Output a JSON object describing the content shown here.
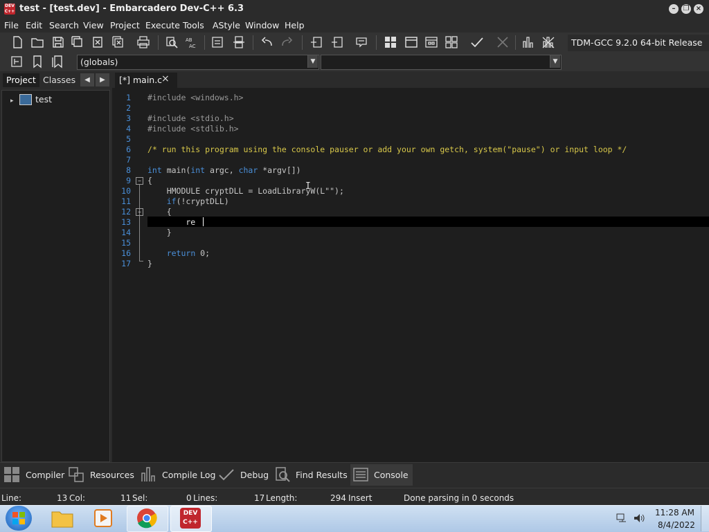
{
  "window": {
    "title": "test - [test.dev] - Embarcadero Dev-C++ 6.3",
    "logo_text": "DEV C++"
  },
  "menu": [
    "File",
    "Edit",
    "Search",
    "View",
    "Project",
    "Execute",
    "Tools",
    "AStyle",
    "Window",
    "Help"
  ],
  "toolbar": {
    "compiler": "TDM-GCC 9.2.0 64-bit Release",
    "scope_select": "(globals)"
  },
  "left_panel": {
    "tabs": [
      "Project",
      "Classes"
    ],
    "tree_root": "test"
  },
  "editor": {
    "tab_label": "[*] main.c",
    "lines": [
      {
        "n": "1",
        "text": "#include <windows.h>"
      },
      {
        "n": "2",
        "text": ""
      },
      {
        "n": "3",
        "text": "#include <stdio.h>"
      },
      {
        "n": "4",
        "text": "#include <stdlib.h>"
      },
      {
        "n": "5",
        "text": ""
      },
      {
        "n": "6",
        "text": "/* run this program using the console pauser or add your own getch, system(\"pause\") or input loop */"
      },
      {
        "n": "7",
        "text": ""
      },
      {
        "n": "8",
        "text": "int main(int argc, char *argv[])"
      },
      {
        "n": "9",
        "text": "{"
      },
      {
        "n": "10",
        "text": "    HMODULE cryptDLL = LoadLibraryW(L\"\");"
      },
      {
        "n": "11",
        "text": "    if(!cryptDLL)"
      },
      {
        "n": "12",
        "text": "    {"
      },
      {
        "n": "13",
        "text": "        re"
      },
      {
        "n": "14",
        "text": "    }"
      },
      {
        "n": "15",
        "text": ""
      },
      {
        "n": "16",
        "text": "    return 0;"
      },
      {
        "n": "17",
        "text": "}"
      }
    ]
  },
  "bottom_tabs": [
    "Compiler",
    "Resources",
    "Compile Log",
    "Debug",
    "Find Results",
    "Console"
  ],
  "status": {
    "line_label": "Line:",
    "line_value": "13",
    "col_label": "Col:",
    "col_value": "11",
    "sel_label": "Sel:",
    "sel_value": "0",
    "lines_label": "Lines:",
    "lines_value": "17",
    "length_label": "Length:",
    "length_value": "294",
    "mode": "Insert",
    "message": "Done parsing in 0 seconds"
  },
  "taskbar": {
    "time": "11:28 AM",
    "date": "8/4/2022"
  }
}
